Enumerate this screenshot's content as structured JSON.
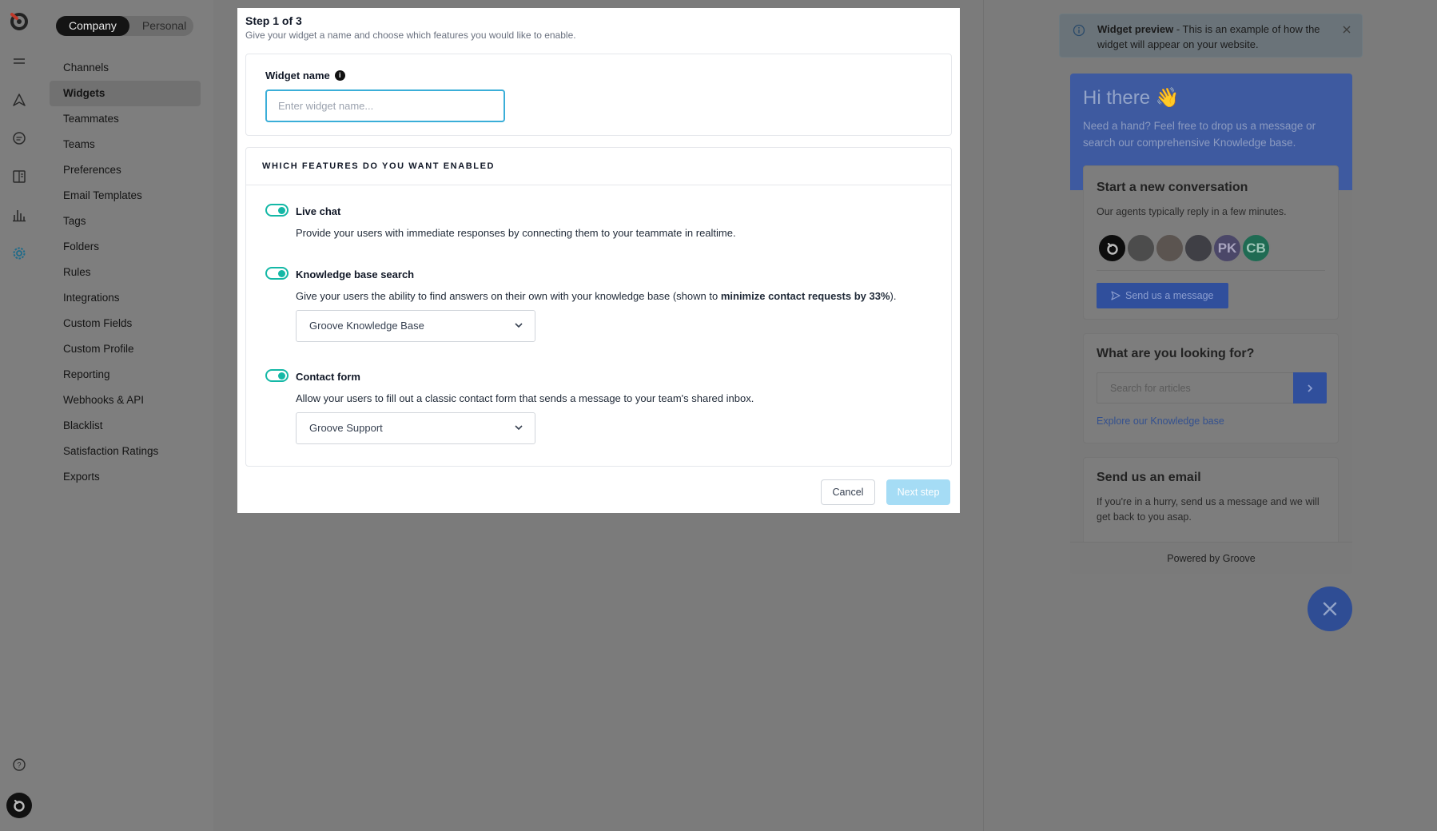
{
  "rail": {
    "icons": [
      "groove-logo-icon",
      "menu-icon",
      "send-icon",
      "chat-icon",
      "book-icon",
      "chart-icon",
      "gear-icon",
      "help-icon",
      "user-avatar-icon"
    ]
  },
  "sidebar": {
    "tabs": [
      {
        "label": "Company",
        "active": true
      },
      {
        "label": "Personal",
        "active": false
      }
    ],
    "items": [
      {
        "label": "Channels"
      },
      {
        "label": "Widgets",
        "active": true
      },
      {
        "label": "Teammates"
      },
      {
        "label": "Teams"
      },
      {
        "label": "Preferences"
      },
      {
        "label": "Email Templates"
      },
      {
        "label": "Tags"
      },
      {
        "label": "Folders"
      },
      {
        "label": "Rules"
      },
      {
        "label": "Integrations"
      },
      {
        "label": "Custom Fields"
      },
      {
        "label": "Custom Profile"
      },
      {
        "label": "Reporting"
      },
      {
        "label": "Webhooks & API"
      },
      {
        "label": "Blacklist"
      },
      {
        "label": "Satisfaction Ratings"
      },
      {
        "label": "Exports"
      }
    ]
  },
  "modal": {
    "step": "Step 1 of 3",
    "subtitle": "Give your widget a name and choose which features you would like to enable.",
    "name_label": "Widget name",
    "name_value": "",
    "name_placeholder": "Enter widget name...",
    "features_heading": "WHICH FEATURES DO YOU WANT ENABLED",
    "features": [
      {
        "title": "Live chat",
        "enabled": true,
        "description": "Provide your users with immediate responses by connecting them to your teammate in realtime."
      },
      {
        "title": "Knowledge base search",
        "enabled": true,
        "description_before": "Give your users the ability to find answers on their own with your knowledge base (shown to ",
        "description_bold": "minimize contact requests by 33%",
        "description_after": ").",
        "select_value": "Groove Knowledge Base"
      },
      {
        "title": "Contact form",
        "enabled": true,
        "description": "Allow your users to fill out a classic contact form that sends a message to your team's shared inbox.",
        "select_value": "Groove Support"
      }
    ],
    "cancel_label": "Cancel",
    "next_label": "Next step"
  },
  "preview_banner": {
    "title": "Widget preview",
    "text": " - This is an example of how the widget will appear on your website."
  },
  "widget": {
    "greeting": "Hi there 👋",
    "intro": "Need a hand? Feel free to drop us a message or search our comprehensive Knowledge base.",
    "conversation": {
      "title": "Start a new conversation",
      "subtitle": "Our agents typically reply in a few minutes.",
      "avatars": [
        "",
        "",
        "",
        "",
        "PK",
        "CB"
      ],
      "button_label": "Send us a message"
    },
    "search": {
      "title": "What are you looking for?",
      "placeholder": "Search for articles",
      "link_label": "Explore our Knowledge base"
    },
    "email": {
      "title": "Send us an email",
      "subtitle": "If you're in a hurry, send us a message and we will get back to you asap."
    },
    "footer": "Powered by Groove"
  },
  "colors": {
    "accent_teal": "#14b8a6",
    "focus_blue": "#3aaed8",
    "next_button_disabled": "#a5dcf5",
    "widget_blue": "#3e5aa0"
  }
}
